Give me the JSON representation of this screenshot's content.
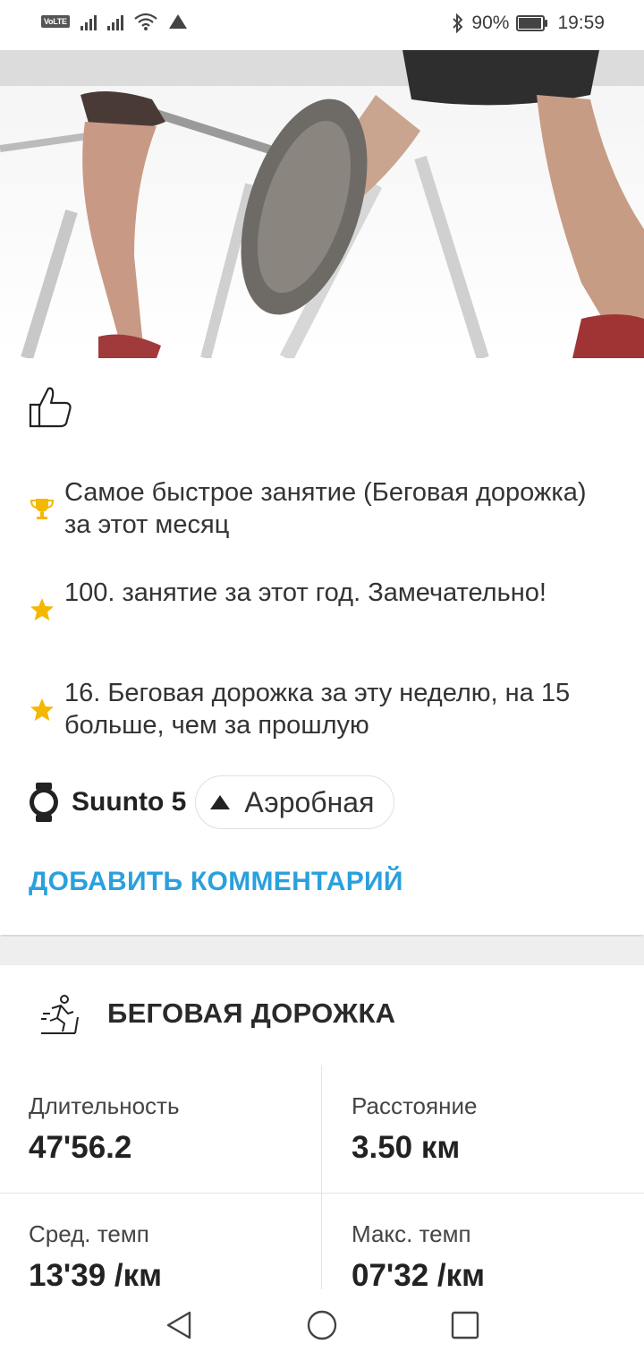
{
  "status_bar": {
    "volte": "VoLTE",
    "bluetooth_battery": "90%",
    "time": "19:59"
  },
  "hero": {
    "image": "treadmill-runners-photo"
  },
  "card": {
    "achievements": [
      {
        "icon": "trophy-icon",
        "icon_color": "#f5b800",
        "text": "Самое быстрое занятие (Беговая дорожка) за этот месяц"
      },
      {
        "icon": "star-icon",
        "icon_color": "#f5b800",
        "text": "100. занятие за этот год. Замечательно!"
      },
      {
        "icon": "star-icon",
        "icon_color": "#f5b800",
        "text": "16. Беговая дорожка за эту неделю, на 15 больше, чем за прошлую"
      }
    ],
    "device_name": "Suunto 5",
    "zone_chip": "Аэробная",
    "add_comment": "ДОБАВИТЬ КОММЕНТАРИЙ",
    "accent_color": "#2aa0dc"
  },
  "activity": {
    "title": "БЕГОВАЯ ДОРОЖКА",
    "icon": "treadmill-runner-icon"
  },
  "stats": [
    {
      "label": "Длительность",
      "value": "47'56.2"
    },
    {
      "label": "Расстояние",
      "value": "3.50 км"
    },
    {
      "label": "Сред. темп",
      "value": "13'39 /км"
    },
    {
      "label": "Макс. темп",
      "value": "07'32 /км"
    }
  ],
  "navbar": [
    "back-icon",
    "home-icon",
    "recents-icon"
  ]
}
